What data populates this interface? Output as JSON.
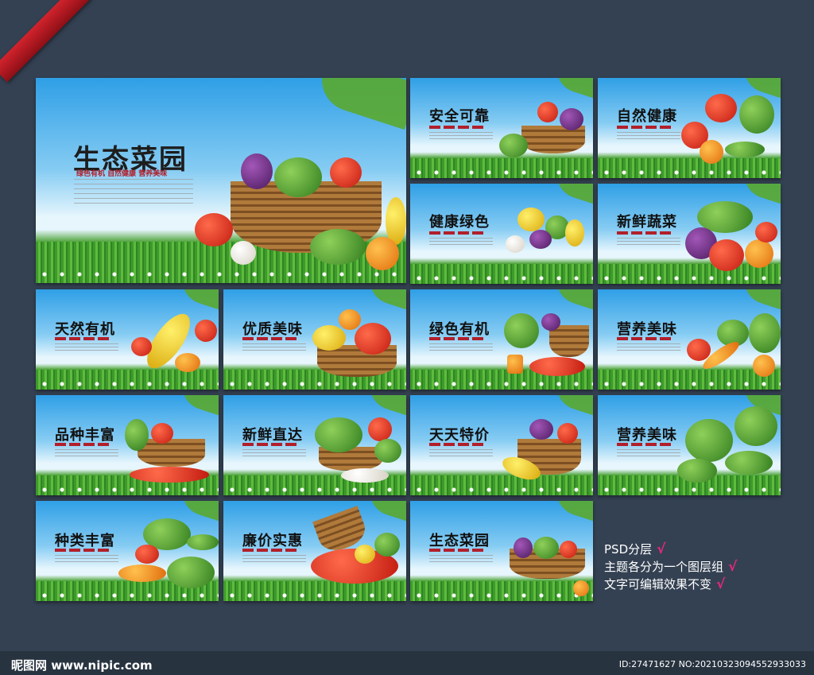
{
  "main_board": {
    "title": "生态菜园",
    "subtitle": "绿色有机  自然健康  营养美味"
  },
  "boards": [
    {
      "title": "安全可靠"
    },
    {
      "title": "自然健康"
    },
    {
      "title": "健康绿色"
    },
    {
      "title": "新鲜蔬菜"
    },
    {
      "title": "天然有机"
    },
    {
      "title": "优质美味"
    },
    {
      "title": "绿色有机"
    },
    {
      "title": "营养美味"
    },
    {
      "title": "品种丰富"
    },
    {
      "title": "新鲜直达"
    },
    {
      "title": "天天特价"
    },
    {
      "title": "营养美味"
    },
    {
      "title": "种类丰富"
    },
    {
      "title": "廉价实惠"
    },
    {
      "title": "生态菜园"
    }
  ],
  "notes": {
    "line1": "PSD分层",
    "line2": "主题各分为一个图层组",
    "line3": "文字可编辑效果不变",
    "check": "√"
  },
  "footer": {
    "logo": "昵图网 www.nipic.com",
    "id": "ID:27471627 NO:20210323094552933033"
  }
}
